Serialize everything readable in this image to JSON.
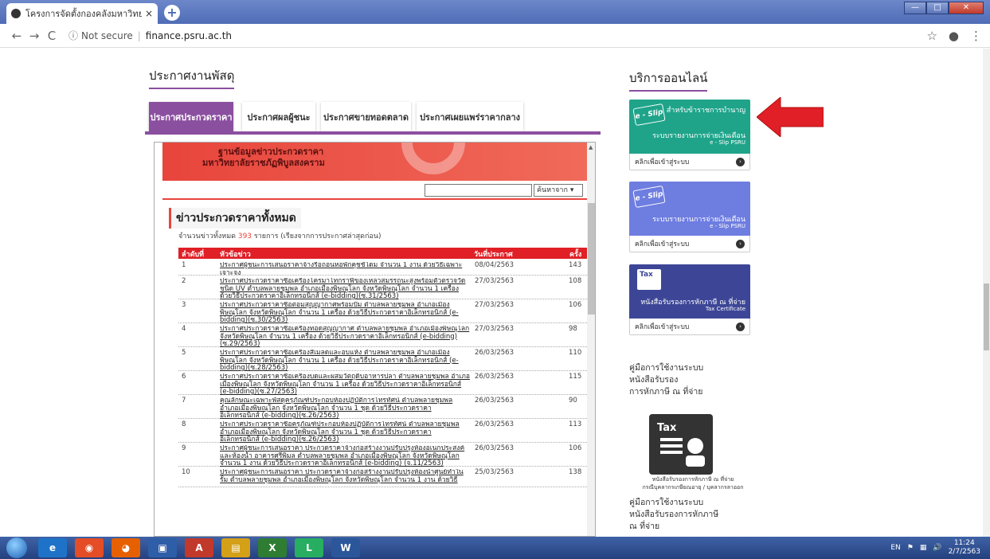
{
  "browser": {
    "tab_title": "โครงการจัดตั้งกองคลังมหาวิทยาลัย",
    "close_glyph": "×",
    "newtab_glyph": "+",
    "security_label": "Not secure",
    "url": "finance.psru.ac.th"
  },
  "page": {
    "left_heading": "ประกาศงานพัสดุ",
    "right_heading": "บริการออนไลน์",
    "tabs": [
      "ประกาศประกวดราคา",
      "ประกาศผลผู้ชนะ",
      "ประกาศขายทอดตลาด",
      "ประกาศเผยแพร่ราคากลาง"
    ]
  },
  "frame": {
    "banner_line1": "ฐานข้อมูลข่าวประกวดราคา",
    "banner_line2": "มหาวิทยาลัยราชภัฏพิบูลสงคราม",
    "search_select": "ค้นหาจาก",
    "section_title": "ข่าวประกวดราคาทั้งหมด",
    "count_prefix": "จำนวนข่าวทั้งหมด",
    "count_value": "393",
    "count_suffix": "รายการ (เรียงจากการประกาศล่าสุดก่อน)",
    "headers": {
      "no": "ลำดับที่",
      "title": "หัวข้อข่าว",
      "date": "วันที่ประกาศ",
      "count": "ครั้ง"
    },
    "rows": [
      {
        "no": "1",
        "title": "ประกาศผู้ชนะการเสนอราคาจ้างรื้อถอนหอพักคุชชั่โดม จำนวน 1 งาน ด้วยวิธีเฉพาะเจาะจง",
        "date": "08/04/2563",
        "count": "143"
      },
      {
        "no": "2",
        "title": "ประกาศประกวดราคาซื้อเครื่องโครมาโทกราฟีของเหลวสมรรถนะสูงพร้อมตัวตรวจวัดชนิด UV ตำบลพลายชุมพล อำเภอเมืองพิษณุโลก จังหวัดพิษณุโลก จำนวน 1 เครื่อง ด้วยวิธีประกวดราคาอิเล็กทรอนิกส์ (e-bidding)(ซ.31/2563)",
        "date": "27/03/2563",
        "count": "108"
      },
      {
        "no": "3",
        "title": "ประกาศประกวดราคาซื้อต่อมสุญญากาศพร้อมปั๊ม ตำบลพลายชุมพล อำเภอเมืองพิษณุโลก จังหวัดพิษณุโลก จำนวน 1 เครื่อง ด้วยวิธีประกวดราคาอิเล็กทรอนิกส์ (e-bidding)(ซ.30/2563)",
        "date": "27/03/2563",
        "count": "106"
      },
      {
        "no": "4",
        "title": "ประกาศประกวดราคาซื้อเครื่องทอดสุญญากาศ ตำบลพลายชุมพล อำเภอเมืองพิษณุโลก จังหวัดพิษณุโลก จำนวน 1 เครื่อง ด้วยวิธีประกวดราคาอิเล็กทรอนิกส์ (e-bidding)(ซ.29/2563)",
        "date": "27/03/2563",
        "count": "98"
      },
      {
        "no": "5",
        "title": "ประกาศประกวดราคาซื้อเครื่องสีเมล็ดและอบแห้ง ตำบลพลายชุมพล อำเภอเมืองพิษณุโลก จังหวัดพิษณุโลก จำนวน 1 เครื่อง ด้วยวิธีประกวดราคาอิเล็กทรอนิกส์ (e-bidding)(ซ.28/2563)",
        "date": "26/03/2563",
        "count": "110"
      },
      {
        "no": "6",
        "title": "ประกาศประกวดราคาซื้อเครื่องบดและผสมวัตถุดิบอาหารปลา ตำบลพลายชุมพล อำเภอเมืองพิษณุโลก จังหวัดพิษณุโลก จำนวน 1 เครื่อง ด้วยวิธีประกวดราคาอิเล็กทรอนิกส์ (e-bidding)(ซ.27/2563)",
        "date": "26/03/2563",
        "count": "115"
      },
      {
        "no": "7",
        "title": "คุณลักษณะเฉพาะพัสดุครุภัณฑ์ประกอบห้องปฏิบัติการโทรทัศน์ ตำบลพลายชุมพล อำเภอเมืองพิษณุโลก จังหวัดพิษณุโลก จำนวน 1 ชุด ด้วยวิธีประกวดราคาอิเล็กทรอนิกส์ (e-bidding)(ซ.26/2563)",
        "date": "26/03/2563",
        "count": "90"
      },
      {
        "no": "8",
        "title": "ประกาศประกวดราคาซื้อครุภัณฑ์ประกอบห้องปฏิบัติการโทรทัศน์ ตำบลพลายชุมพล อำเภอเมืองพิษณุโลก จังหวัดพิษณุโลก จำนวน 1 ชุด ด้วยวิธีประกวดราคาอิเล็กทรอนิกส์ (e-bidding)(ซ.26/2563)",
        "date": "26/03/2563",
        "count": "113"
      },
      {
        "no": "9",
        "title": "ประกาศผู้ชนะการเสนอราคา ประกวดราคาจ้างก่อสร้างงานปรับปรุงห้องอเนกประสงค์และห้องน้ำ อาคารศรีพิมล ตำบลพลายชุมพล อำเภอเมืองพิษณุโลก จังหวัดพิษณุโลก จำนวน 1 งาน ด้วยวิธีประกวดราคาอิเล็กทรอนิกส์ (e-bidding) (จ.11/2563)",
        "date": "26/03/2563",
        "count": "106"
      },
      {
        "no": "10",
        "title": "ประกาศผู้ชนะการเสนอราคา ประกวดราคาจ้างก่อสร้างงานปรับปรุงห้องน้ำศูนย์ทำในรั้ม ตำบลพลายชุมพล อำเภอเมืองพิษณุโลก จังหวัดพิษณุโลก จำนวน 1 งาน ด้วยวิธี",
        "date": "25/03/2563",
        "count": "138"
      }
    ]
  },
  "services": {
    "card1": {
      "badge": "e - Slip",
      "tagline": "สำหรับข้าราชการบำนาญ",
      "line1": "ระบบรายงานการจ่ายเงินเดือน",
      "line2": "e - Slip PSRU",
      "link": "คลิกเพื่อเข้าสู่ระบบ"
    },
    "card2": {
      "badge": "e - Slip",
      "line1": "ระบบรายงานการจ่ายเงินเดือน",
      "line2": "e - Slip PSRU",
      "link": "คลิกเพื่อเข้าสู่ระบบ"
    },
    "card3": {
      "badge": "Tax",
      "line1": "หนังสือรับรองการหักภาษี ณ ที่จ่าย",
      "line2": "Tax Certificate",
      "link": "คลิกเพื่อเข้าสู่ระบบ"
    },
    "manual1": [
      "คู่มือการใช้งานระบบ",
      "หนังสือรับรอง",
      "การหักภาษี ณ ที่จ่าย"
    ],
    "tax_big_label": "Tax",
    "tax_caption1": "หนังสือรับรองการหักภาษี ณ ที่จ่าย",
    "tax_caption2": "กรณีบุคลากรเกษียณอายุ / บุคลากรลาออก",
    "manual2": [
      "คู่มือการใช้งานระบบ",
      "หนังสือรับรองการหักภาษี",
      "ณ ที่จ่าย"
    ]
  },
  "taskbar": {
    "lang": "EN",
    "time": "11:24",
    "date": "2/7/2563",
    "apps": [
      "ie-icon",
      "chrome-icon",
      "firefox-icon",
      "dashboard-icon",
      "acrobat-icon",
      "explorer-icon",
      "excel-icon",
      "line-icon",
      "word-icon"
    ]
  },
  "colors": {
    "accent": "#8b4fa0",
    "banner": "#e8453c",
    "card_green": "#1fa48a",
    "card_blue": "#6e7de0",
    "card_navy": "#3d4696",
    "arrow": "#e01f26"
  }
}
